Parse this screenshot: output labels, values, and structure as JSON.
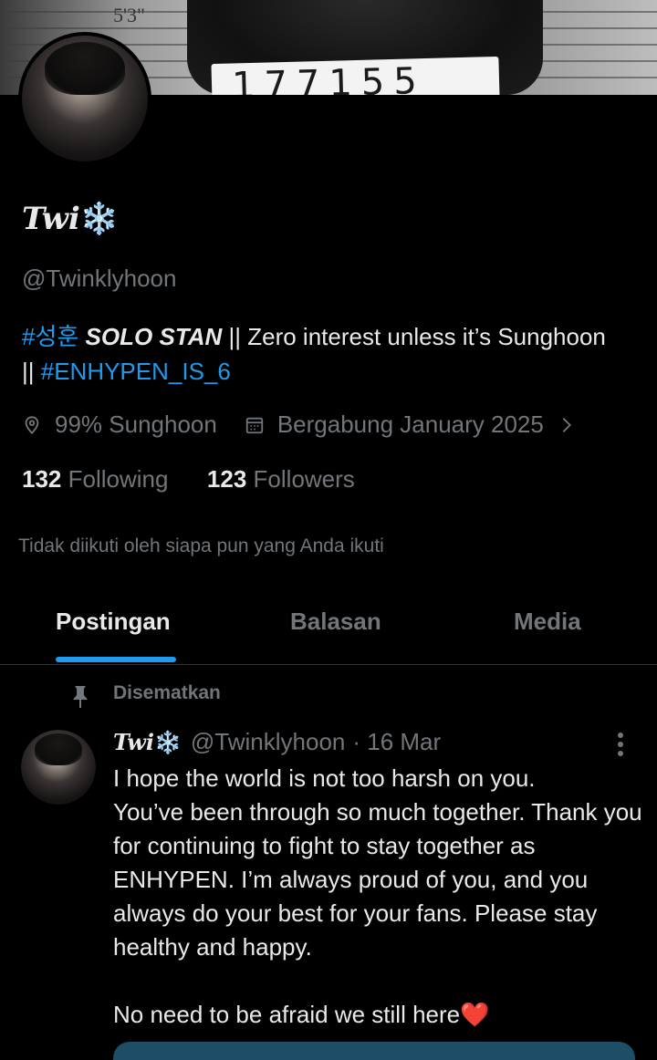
{
  "banner": {
    "height_label": "5'3\"",
    "board_number": "177155"
  },
  "profile": {
    "display_name": "Twi",
    "display_emoji": "❄️",
    "handle": "@Twinklyhoon",
    "bio": {
      "tag1": "#성훈",
      "bold": "SOLO STAN",
      "rest": " || Zero interest unless it’s Sunghoon",
      "sep": "|| ",
      "tag2": "#ENHYPEN_IS_6"
    },
    "location": "99% Sunghoon",
    "joined": "Bergabung January 2025",
    "following_count": "132",
    "following_label": "Following",
    "followers_count": "123",
    "followers_label": "Followers",
    "not_followed_text": "Tidak diikuti oleh siapa pun yang Anda ikuti"
  },
  "tabs": [
    {
      "label": "Postingan",
      "active": true
    },
    {
      "label": "Balasan",
      "active": false
    },
    {
      "label": "Media",
      "active": false
    }
  ],
  "post": {
    "pinned_label": "Disematkan",
    "author_name": "Twi",
    "author_emoji": "❄️",
    "handle": "@Twinklyhoon",
    "date": "· 16 Mar",
    "text": "I hope the world is not too harsh on you.\nYou’ve been through so much together. Thank you for continuing to fight to stay together as ENHYPEN. I’m always proud of you, and you always do your best for your fans. Please stay healthy and happy.\n\nNo need to be afraid we still here❤️"
  },
  "icons": {
    "location": "location-pin-icon",
    "calendar": "calendar-icon",
    "chevron": "chevron-right-icon",
    "pin": "pin-icon",
    "more": "more-vertical-icon"
  },
  "colors": {
    "accent": "#1d9bf0",
    "muted": "#71767b",
    "text": "#e7e9ea",
    "background": "#000000"
  }
}
